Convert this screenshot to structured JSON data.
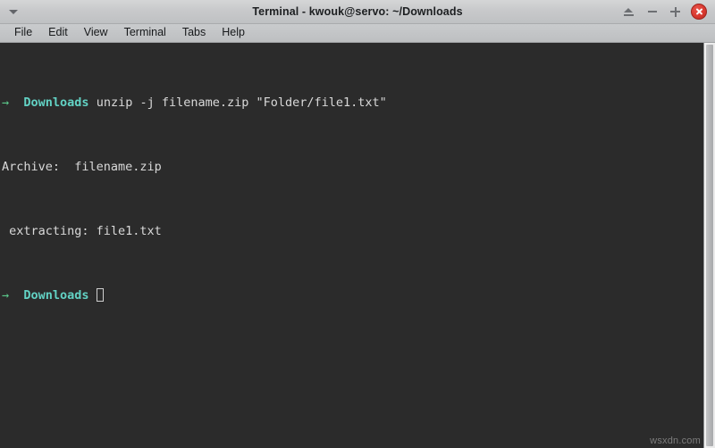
{
  "window": {
    "title": "Terminal - kwouk@servo: ~/Downloads",
    "menu_button_icon": "chevron-down-icon",
    "controls": {
      "shade_label": "Shade",
      "minimize_label": "Minimize",
      "maximize_label": "Maximize",
      "close_label": "Close"
    }
  },
  "menubar": {
    "items": [
      {
        "label": "File"
      },
      {
        "label": "Edit"
      },
      {
        "label": "View"
      },
      {
        "label": "Terminal"
      },
      {
        "label": "Tabs"
      },
      {
        "label": "Help"
      }
    ]
  },
  "terminal": {
    "colors": {
      "background": "#2b2b2b",
      "foreground": "#d9d9d9",
      "prompt_arrow": "#5bc98b",
      "prompt_dir": "#62d2c4"
    },
    "lines": [
      {
        "prompt_arrow": "→",
        "prompt_dir": "Downloads",
        "command": " unzip -j filename.zip \"Folder/file1.txt\""
      },
      {
        "text": "Archive:  filename.zip"
      },
      {
        "text": " extracting: file1.txt"
      },
      {
        "prompt_arrow": "→",
        "prompt_dir": "Downloads",
        "command": " "
      }
    ]
  },
  "scrollbar": {
    "position": "right",
    "thumb_label": "scroll-thumb"
  },
  "watermark": {
    "text": "wsxdn.com"
  }
}
